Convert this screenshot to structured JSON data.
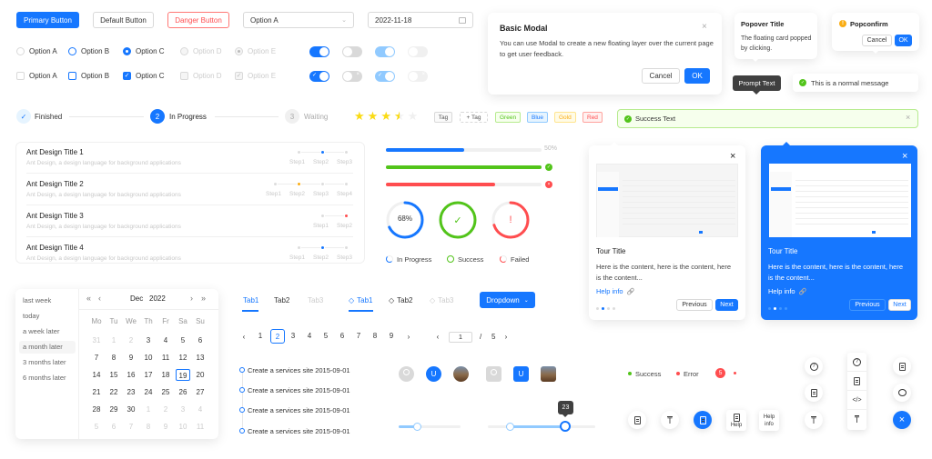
{
  "buttons": {
    "primary": "Primary Button",
    "default": "Default Button",
    "danger": "Danger Button"
  },
  "select": {
    "value": "Option A",
    "arrow_icon": "chevron-down-icon"
  },
  "datepicker": {
    "value": "2022-11-18",
    "icon": "calendar-icon"
  },
  "radios": [
    {
      "label": "Option A",
      "state": "default"
    },
    {
      "label": "Option B",
      "state": "hover"
    },
    {
      "label": "Option C",
      "state": "checked"
    },
    {
      "label": "Option D",
      "state": "disabled"
    },
    {
      "label": "Option E",
      "state": "disabled-checked"
    }
  ],
  "checkboxes": [
    {
      "label": "Option A",
      "state": "default"
    },
    {
      "label": "Option B",
      "state": "hover"
    },
    {
      "label": "Option C",
      "state": "checked"
    },
    {
      "label": "Option D",
      "state": "disabled"
    },
    {
      "label": "Option E",
      "state": "disabled-checked"
    }
  ],
  "switches": {
    "row1": [
      "on",
      "off",
      "on-disabled",
      "off-disabled"
    ],
    "row2": [
      "on-check",
      "off-x",
      "on-check-disabled",
      "off-x-disabled"
    ]
  },
  "steps": [
    {
      "label": "Finished",
      "status": "finish",
      "icon": "check"
    },
    {
      "label": "In Progress",
      "status": "process",
      "number": "2"
    },
    {
      "label": "Waiting",
      "status": "wait",
      "number": "3"
    }
  ],
  "rate": {
    "value": 3.5,
    "max": 5
  },
  "tags": {
    "basic": "Tag",
    "add": "+ Tag",
    "colored": [
      {
        "label": "Green",
        "color": "#52c41a",
        "bg": "#f6ffed",
        "border": "#b7eb8f"
      },
      {
        "label": "Blue",
        "color": "#1677ff",
        "bg": "#e6f4ff",
        "border": "#91caff"
      },
      {
        "label": "Gold",
        "color": "#faad14",
        "bg": "#fffbe6",
        "border": "#ffe58f"
      },
      {
        "label": "Red",
        "color": "#ff4d4f",
        "bg": "#fff1f0",
        "border": "#ffa39e"
      }
    ]
  },
  "modal": {
    "title": "Basic Modal",
    "body": "You can use Modal to create a new floating layer over the current page to get user feedback.",
    "cancel": "Cancel",
    "ok": "OK"
  },
  "popover": {
    "title": "Popover Title",
    "body": "The floating card popped by clicking."
  },
  "popconfirm": {
    "title": "Popconfirm",
    "cancel": "Cancel",
    "ok": "OK"
  },
  "tooltip": {
    "text": "Prompt Text"
  },
  "message": {
    "text": "This is a normal message"
  },
  "alert": {
    "text": "Success Text"
  },
  "list": [
    {
      "title": "Ant Design Title 1",
      "desc": "Ant Design, a design language for background applications",
      "steps": [
        "Step1",
        "Step2",
        "Step3"
      ],
      "current": 1,
      "color": "#1677ff"
    },
    {
      "title": "Ant Design Title 2",
      "desc": "Ant Design, a design language for background applications",
      "steps": [
        "Step1",
        "Step2",
        "Step3",
        "Step4"
      ],
      "current": 1,
      "color": "#faad14"
    },
    {
      "title": "Ant Design Title 3",
      "desc": "Ant Design, a design language for background applications",
      "steps": [
        "Step1",
        "Step2"
      ],
      "current": 1,
      "color": "#ff4d4f"
    },
    {
      "title": "Ant Design Title 4",
      "desc": "Ant Design, a design language for background applications",
      "steps": [
        "Step1",
        "Step2",
        "Step3"
      ],
      "current": 1,
      "color": "#1677ff"
    }
  ],
  "progress": {
    "lines": [
      {
        "percent": 50,
        "status": "normal",
        "label": "50%"
      },
      {
        "percent": 100,
        "status": "success"
      },
      {
        "percent": 70,
        "status": "exception"
      }
    ],
    "circles": [
      {
        "percent": 68,
        "status": "normal",
        "label": "68%"
      },
      {
        "percent": 100,
        "status": "success",
        "label": "✓"
      },
      {
        "percent": 70,
        "status": "exception",
        "label": "!"
      }
    ],
    "mini": [
      {
        "label": "In Progress",
        "status": "normal"
      },
      {
        "label": "Success",
        "status": "success"
      },
      {
        "label": "Failed",
        "status": "exception"
      }
    ]
  },
  "tours": [
    {
      "theme": "light",
      "title": "Tour Title",
      "body": "Here is the content, here is the content, here is the content...",
      "help": "Help info",
      "prev": "Previous",
      "next": "Next",
      "current": 1,
      "total": 4
    },
    {
      "theme": "primary",
      "title": "Tour Title",
      "body": "Here is the content, here is the content, here is the content...",
      "help": "Help info",
      "prev": "Previous",
      "next": "Next",
      "current": 1,
      "total": 4
    }
  ],
  "calendar": {
    "presets": [
      "last week",
      "today",
      "a week later",
      "a month later",
      "3 months later",
      "6 months later"
    ],
    "active_preset": 3,
    "month": "Dec",
    "year": "2022",
    "weekdays": [
      "Mo",
      "Tu",
      "We",
      "Th",
      "Fr",
      "Sa",
      "Su"
    ],
    "weeks": [
      [
        [
          "31",
          1
        ],
        [
          "1",
          1
        ],
        [
          "2",
          1
        ],
        [
          "3",
          0
        ],
        [
          "4",
          0
        ],
        [
          "5",
          0
        ],
        [
          "6",
          0
        ]
      ],
      [
        [
          "7",
          0
        ],
        [
          "8",
          0
        ],
        [
          "9",
          0
        ],
        [
          "10",
          0
        ],
        [
          "11",
          0
        ],
        [
          "12",
          0
        ],
        [
          "13",
          0
        ]
      ],
      [
        [
          "14",
          0
        ],
        [
          "15",
          0
        ],
        [
          "16",
          0
        ],
        [
          "17",
          0
        ],
        [
          "18",
          0
        ],
        [
          "19",
          0
        ],
        [
          "20",
          0
        ]
      ],
      [
        [
          "21",
          0
        ],
        [
          "22",
          0
        ],
        [
          "23",
          0
        ],
        [
          "24",
          0
        ],
        [
          "25",
          0
        ],
        [
          "26",
          0
        ],
        [
          "27",
          0
        ]
      ],
      [
        [
          "28",
          0
        ],
        [
          "29",
          0
        ],
        [
          "30",
          0
        ],
        [
          "1",
          1
        ],
        [
          "2",
          1
        ],
        [
          "3",
          1
        ],
        [
          "4",
          1
        ]
      ],
      [
        [
          "5",
          1
        ],
        [
          "6",
          1
        ],
        [
          "7",
          1
        ],
        [
          "8",
          1
        ],
        [
          "9",
          1
        ],
        [
          "10",
          1
        ],
        [
          "11",
          1
        ]
      ]
    ],
    "selected": "19"
  },
  "tabs1": [
    {
      "label": "Tab1",
      "state": "active"
    },
    {
      "label": "Tab2",
      "state": "normal"
    },
    {
      "label": "Tab3",
      "state": "disabled"
    }
  ],
  "tabs2": [
    {
      "label": "Tab1",
      "state": "active"
    },
    {
      "label": "Tab2",
      "state": "normal"
    },
    {
      "label": "Tab3",
      "state": "disabled"
    }
  ],
  "dropdown": {
    "label": "Dropdown"
  },
  "pagination": {
    "pages": [
      "1",
      "2",
      "3",
      "4",
      "5",
      "6",
      "7",
      "8",
      "9"
    ],
    "current": "2"
  },
  "simple_pagination": {
    "value": "1",
    "total": "5",
    "sep": "/"
  },
  "timeline": [
    "Create a services site 2015-09-01",
    "Create a services site 2015-09-01",
    "Create a services site 2015-09-01",
    "Create a services site 2015-09-01"
  ],
  "avatars": {
    "letter": "U"
  },
  "sliders": [
    {
      "value": 30
    },
    {
      "range": [
        20,
        72
      ],
      "tooltip": "23"
    }
  ],
  "badges": {
    "success": "Success",
    "error": "Error",
    "count": "5"
  },
  "float_buttons": {
    "help_label": "Help",
    "help_info_label": "Help\ninfo"
  }
}
